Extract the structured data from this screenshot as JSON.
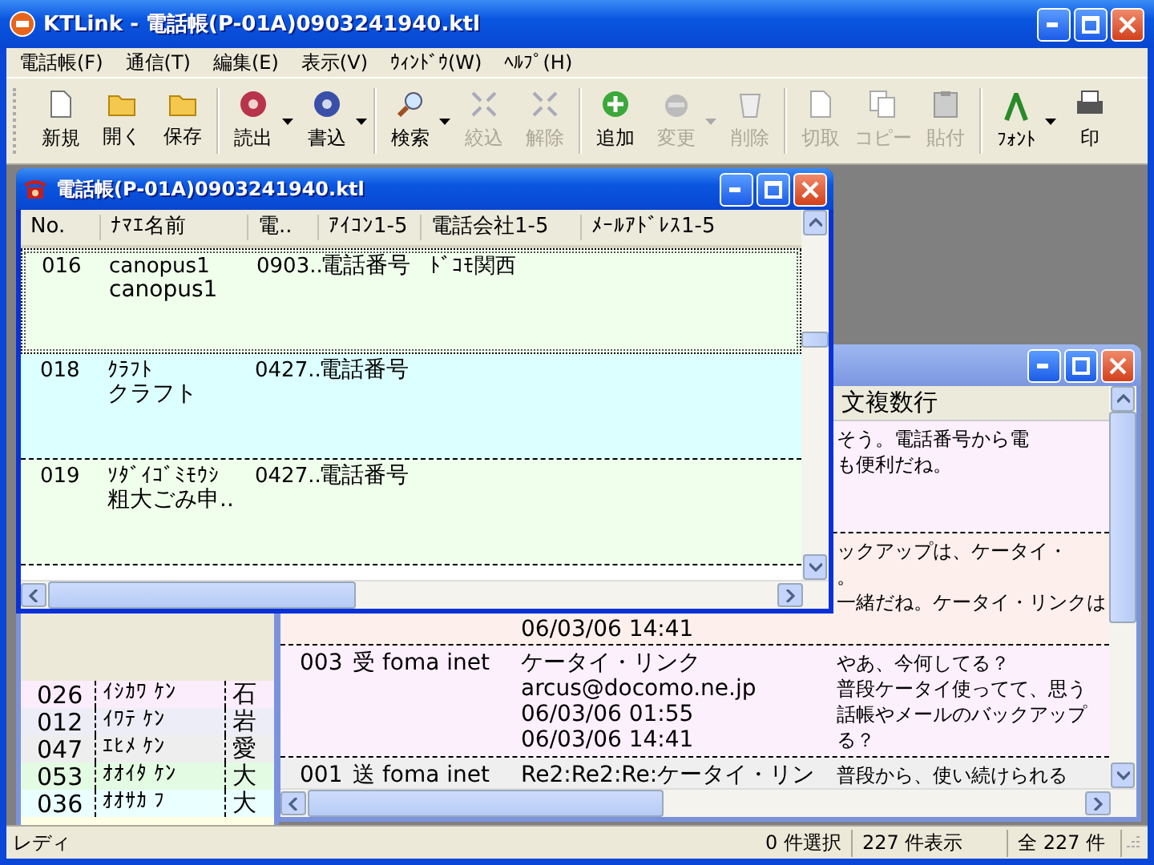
{
  "window": {
    "title": "KTLink - 電話帳(P-01A)0903241940.ktl"
  },
  "menu": [
    "電話帳(F)",
    "通信(T)",
    "編集(E)",
    "表示(V)",
    "ｳｨﾝﾄﾞｳ(W)",
    "ﾍﾙﾌﾟ(H)"
  ],
  "toolbar": [
    {
      "label": "新規",
      "disabled": false,
      "dropdown": false,
      "separator_after": false
    },
    {
      "label": "開く",
      "disabled": false,
      "dropdown": false,
      "separator_after": false
    },
    {
      "label": "保存",
      "disabled": false,
      "dropdown": false,
      "separator_after": true
    },
    {
      "label": "読出",
      "disabled": false,
      "dropdown": true,
      "separator_after": false
    },
    {
      "label": "書込",
      "disabled": false,
      "dropdown": true,
      "separator_after": true
    },
    {
      "label": "検索",
      "disabled": false,
      "dropdown": true,
      "separator_after": false
    },
    {
      "label": "絞込",
      "disabled": true,
      "dropdown": false,
      "separator_after": false
    },
    {
      "label": "解除",
      "disabled": true,
      "dropdown": false,
      "separator_after": true
    },
    {
      "label": "追加",
      "disabled": false,
      "dropdown": false,
      "separator_after": false
    },
    {
      "label": "変更",
      "disabled": true,
      "dropdown": true,
      "separator_after": false
    },
    {
      "label": "削除",
      "disabled": true,
      "dropdown": false,
      "separator_after": true
    },
    {
      "label": "切取",
      "disabled": true,
      "dropdown": false,
      "separator_after": false
    },
    {
      "label": "コピー",
      "disabled": true,
      "dropdown": false,
      "separator_after": false
    },
    {
      "label": "貼付",
      "disabled": true,
      "dropdown": false,
      "separator_after": true
    },
    {
      "label": "ﾌｫﾝﾄ",
      "disabled": false,
      "dropdown": true,
      "separator_after": false
    },
    {
      "label": "印",
      "disabled": false,
      "dropdown": false,
      "separator_after": false
    }
  ],
  "list_window": {
    "rows": [
      {
        "no": "026",
        "kana": "ｲｼｶﾜ ｹﾝ",
        "column_3": "石",
        "color": "#fcedfc"
      },
      {
        "no": "012",
        "kana": "ｲﾜﾃ ｹﾝ",
        "column_3": "岩",
        "color": "#ededf8"
      },
      {
        "no": "047",
        "kana": "ｴﾋﾒ ｹﾝ",
        "column_3": "愛",
        "color": "#eeeeee"
      },
      {
        "no": "053",
        "kana": "ｵｵｲﾀ ｹﾝ",
        "column_3": "大",
        "color": "#e3fbe3"
      },
      {
        "no": "036",
        "kana": "ｵｵｻｶ ﾌ",
        "column_3": "大",
        "color": "#eaffff"
      }
    ]
  },
  "mail_window": {
    "header": "文複数行",
    "rows": [
      {
        "subject_lines": [],
        "body_lines": [
          "そう。電話番号から電",
          "も便利だね。"
        ],
        "color": "#fdf0fd"
      },
      {
        "subject_lines": [
          "06/03/06 14:41"
        ],
        "body_lines": [
          "ックアップは、ケータイ・",
          "。",
          "一緒だね。ケータイ・リンクは"
        ],
        "color": "#fdefeb"
      },
      {
        "no": "003",
        "type": "受 foma inet",
        "subject_lines": [
          "ケータイ・リンク",
          "arcus@docomo.ne.jp",
          "06/03/06 01:55",
          "06/03/06 14:41"
        ],
        "body_lines": [
          "やあ、今何してる？",
          "普段ケータイ使ってて、思う",
          "話帳やメールのバックアップ",
          "る？"
        ],
        "color": "#fdf0fd"
      },
      {
        "no": "001",
        "type": "送 foma inet",
        "subject_lines": [
          "Re2:Re2:Re:ケータイ・リン"
        ],
        "body_lines": [
          "普段から、使い続けられる"
        ],
        "color": "#efefef"
      }
    ]
  },
  "phonebook_window": {
    "title": "電話帳(P-01A)0903241940.ktl",
    "active": true,
    "columns": [
      "No.",
      "ﾅﾏｴ名前",
      "電..",
      "ｱｲｺﾝ1-5",
      "電話会社1-5",
      "ﾒｰﾙｱﾄﾞﾚｽ1-5"
    ],
    "rows": [
      {
        "no": "016",
        "kana": "canopus1",
        "name": "canopus1",
        "phone": "0903..",
        "icon": "電話番号",
        "carrier": "ﾄﾞｺﾓ関西",
        "color": "#f0ffec",
        "selected": true
      },
      {
        "no": "018",
        "kana": "ｸﾗﾌﾄ",
        "name": "クラフト",
        "phone": "0427..",
        "icon": "電話番号",
        "color": "#dcffff",
        "selected": false
      },
      {
        "no": "019",
        "kana": "ｿﾀﾞｲｺﾞﾐﾓｳｼ",
        "name": "粗大ごみ申..",
        "phone": "0427..",
        "icon": "電話番号",
        "color": "#f0ffec",
        "selected": false
      }
    ]
  },
  "status_bar": {
    "message": "レディ",
    "selected": "0 件選択",
    "shown": "227 件表示",
    "total": "全 227 件"
  }
}
